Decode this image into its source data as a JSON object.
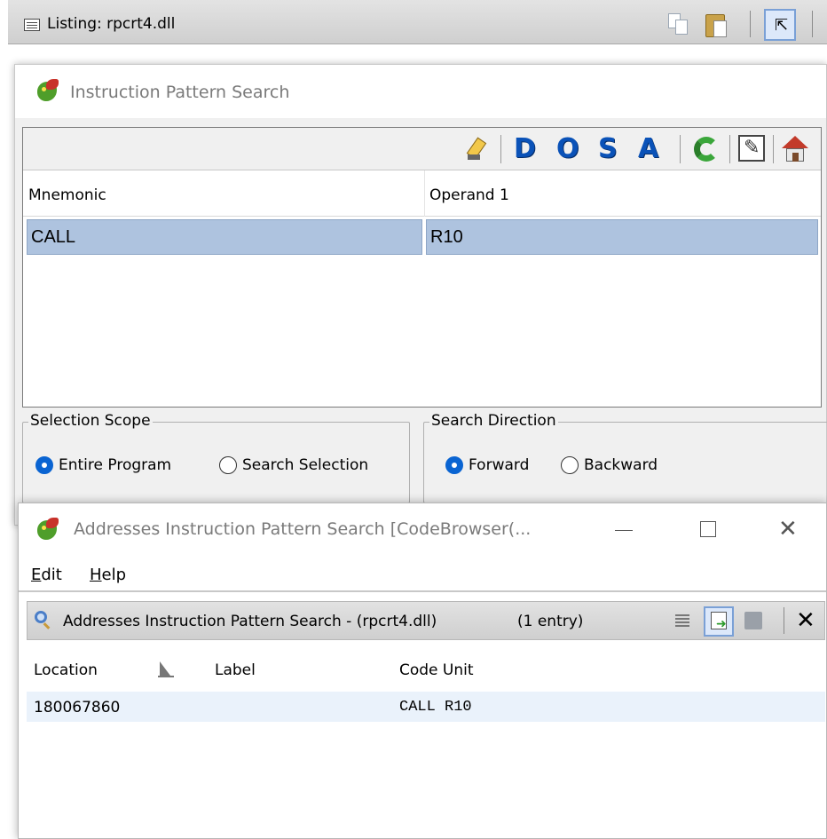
{
  "listing": {
    "title": "Listing: rpcrt4.dll"
  },
  "instruction_search": {
    "title": "Instruction Pattern Search",
    "toolbar": {
      "d": "D",
      "o": "O",
      "s": "S",
      "a": "A"
    },
    "columns": [
      "Mnemonic",
      "Operand 1"
    ],
    "rows": [
      {
        "mnemonic": "CALL",
        "operand1": "R10"
      }
    ],
    "selection_scope": {
      "label": "Selection Scope",
      "options": [
        "Entire Program",
        "Search Selection"
      ],
      "selected": "Entire Program"
    },
    "search_direction": {
      "label": "Search Direction",
      "options": [
        "Forward",
        "Backward"
      ],
      "selected": "Forward"
    }
  },
  "addresses_window": {
    "title": "Addresses Instruction Pattern Search [CodeBrowser(...",
    "menu": {
      "edit": "E",
      "edit_rest": "dit",
      "help": "H",
      "help_rest": "elp"
    },
    "results": {
      "title": "Addresses Instruction Pattern Search - (rpcrt4.dll)",
      "count": "(1 entry)",
      "columns": [
        "Location",
        "Label",
        "Code Unit"
      ],
      "rows": [
        {
          "location": "180067860",
          "label": "",
          "code_unit": "CALL R10"
        }
      ]
    }
  },
  "colors": {
    "selection": "#aec3df",
    "radio_on": "#0a64d2",
    "toolbar_letters": "#0a52b8"
  }
}
